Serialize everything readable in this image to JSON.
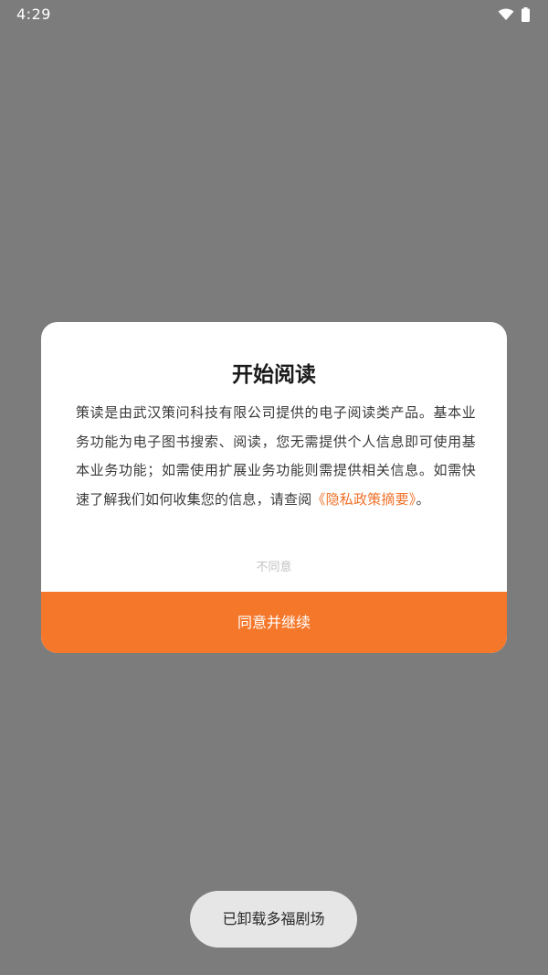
{
  "status_bar": {
    "time": "4:29",
    "icons": [
      "wifi-icon",
      "battery-icon"
    ]
  },
  "dialog": {
    "title": "开始阅读",
    "body_text": "策读是由武汉策问科技有限公司提供的电子阅读类产品。基本业务功能为电子图书搜索、阅读，您无需提供个人信息即可使用基本业务功能；如需使用扩展业务功能则需提供相关信息。如需快速了解我们如何收集您的信息，请查阅",
    "policy_link": "《隐私政策摘要》",
    "body_suffix": "。",
    "disagree_label": "不同意",
    "agree_label": "同意并继续"
  },
  "toast": {
    "text": "已卸载多福剧场"
  },
  "colors": {
    "overlay": "#7c7c7c",
    "accent": "#f5772a",
    "link": "#f0712a"
  }
}
